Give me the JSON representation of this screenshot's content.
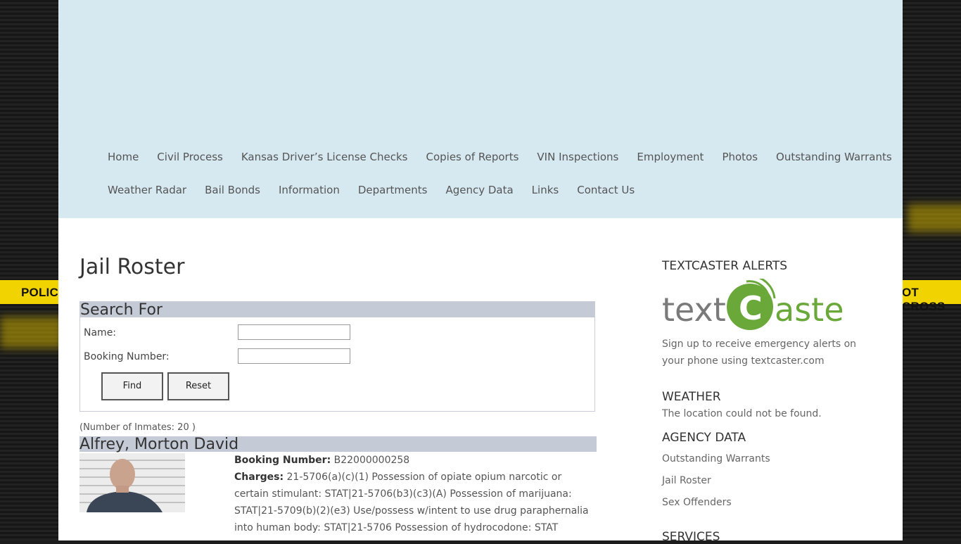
{
  "nav": {
    "row1": [
      "Home",
      "Civil Process",
      "Kansas Driver’s License Checks",
      "Copies of Reports",
      "VIN Inspections",
      "Employment",
      "Photos",
      "Outstanding Warrants"
    ],
    "row2": [
      "Weather Radar",
      "Bail Bonds",
      "Information",
      "Departments",
      "Agency Data",
      "Links",
      "Contact Us"
    ]
  },
  "tape": {
    "left_text": "POLIC",
    "right_text": "OT CROSS"
  },
  "main": {
    "title": "Jail Roster",
    "search": {
      "heading": "Search For",
      "name_label": "Name:",
      "name_value": "",
      "booking_label": "Booking Number:",
      "booking_value": "",
      "find_label": "Find",
      "reset_label": "Reset"
    },
    "inmate_count": "(Number of Inmates: 20 )",
    "inmate": {
      "name": "Alfrey, Morton David",
      "booking_label": "Booking Number:",
      "booking_number": "B22000000258",
      "charges_label": "Charges:",
      "charges": "21-5706(a)(c)(1) Possession of opiate opium narcotic or certain stimulant: STAT|21-5706(b3)(c3)(A) Possession of marijuana: STAT|21-5709(b)(2)(e3) Use/possess w/intent to use drug paraphernalia into human body: STAT|21-5706 Possession of hydrocodone: STAT"
    }
  },
  "sidebar": {
    "textcaster_heading": "TEXTCASTER ALERTS",
    "textcaster_logo_left": "text",
    "textcaster_logo_c": "C",
    "textcaster_logo_right": "aster",
    "textcaster_desc": "Sign up to receive emergency alerts on your phone using textcaster.com",
    "weather_heading": "WEATHER",
    "weather_text": "The location could not be found.",
    "agency_heading": "AGENCY DATA",
    "agency_links": [
      "Outstanding Warrants",
      "Jail Roster",
      "Sex Offenders"
    ],
    "services_heading": "SERVICES"
  },
  "colors": {
    "header_bg": "#d6e8f0",
    "section_bar": "#c4cad6",
    "tape_yellow": "#f0d300",
    "textcaster_green": "#6aa83a"
  }
}
